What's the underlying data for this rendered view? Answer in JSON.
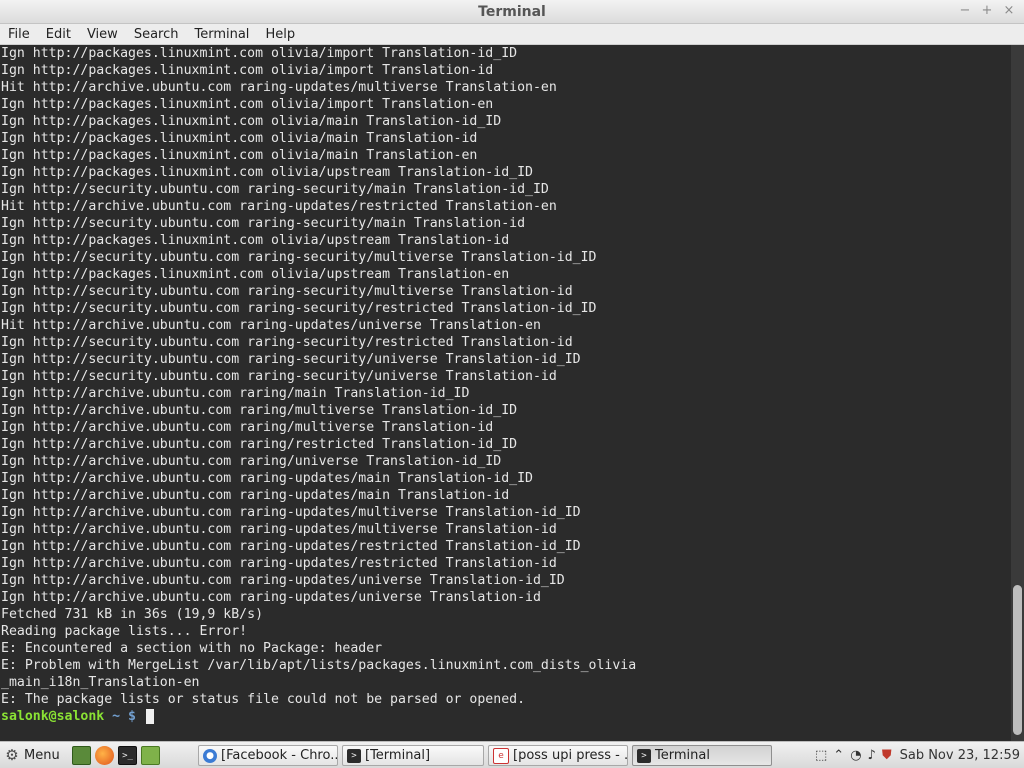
{
  "window": {
    "title": "Terminal"
  },
  "window_controls": {
    "minimize": "−",
    "maximize": "+",
    "close": "×"
  },
  "menubar": [
    "File",
    "Edit",
    "View",
    "Search",
    "Terminal",
    "Help"
  ],
  "terminal": {
    "lines": [
      "Ign http://packages.linuxmint.com olivia/import Translation-id_ID",
      "Ign http://packages.linuxmint.com olivia/import Translation-id",
      "Hit http://archive.ubuntu.com raring-updates/multiverse Translation-en",
      "Ign http://packages.linuxmint.com olivia/import Translation-en",
      "Ign http://packages.linuxmint.com olivia/main Translation-id_ID",
      "Ign http://packages.linuxmint.com olivia/main Translation-id",
      "Ign http://packages.linuxmint.com olivia/main Translation-en",
      "Ign http://packages.linuxmint.com olivia/upstream Translation-id_ID",
      "Ign http://security.ubuntu.com raring-security/main Translation-id_ID",
      "Hit http://archive.ubuntu.com raring-updates/restricted Translation-en",
      "Ign http://security.ubuntu.com raring-security/main Translation-id",
      "Ign http://packages.linuxmint.com olivia/upstream Translation-id",
      "Ign http://security.ubuntu.com raring-security/multiverse Translation-id_ID",
      "Ign http://packages.linuxmint.com olivia/upstream Translation-en",
      "Ign http://security.ubuntu.com raring-security/multiverse Translation-id",
      "Ign http://security.ubuntu.com raring-security/restricted Translation-id_ID",
      "Hit http://archive.ubuntu.com raring-updates/universe Translation-en",
      "Ign http://security.ubuntu.com raring-security/restricted Translation-id",
      "Ign http://security.ubuntu.com raring-security/universe Translation-id_ID",
      "Ign http://security.ubuntu.com raring-security/universe Translation-id",
      "Ign http://archive.ubuntu.com raring/main Translation-id_ID",
      "Ign http://archive.ubuntu.com raring/multiverse Translation-id_ID",
      "Ign http://archive.ubuntu.com raring/multiverse Translation-id",
      "Ign http://archive.ubuntu.com raring/restricted Translation-id_ID",
      "Ign http://archive.ubuntu.com raring/universe Translation-id_ID",
      "Ign http://archive.ubuntu.com raring-updates/main Translation-id_ID",
      "Ign http://archive.ubuntu.com raring-updates/main Translation-id",
      "Ign http://archive.ubuntu.com raring-updates/multiverse Translation-id_ID",
      "Ign http://archive.ubuntu.com raring-updates/multiverse Translation-id",
      "Ign http://archive.ubuntu.com raring-updates/restricted Translation-id_ID",
      "Ign http://archive.ubuntu.com raring-updates/restricted Translation-id",
      "Ign http://archive.ubuntu.com raring-updates/universe Translation-id_ID",
      "Ign http://archive.ubuntu.com raring-updates/universe Translation-id",
      "Fetched 731 kB in 36s (19,9 kB/s)",
      "Reading package lists... Error!",
      "E: Encountered a section with no Package: header",
      "E: Problem with MergeList /var/lib/apt/lists/packages.linuxmint.com_dists_olivia",
      "_main_i18n_Translation-en",
      "E: The package lists or status file could not be parsed or opened."
    ],
    "prompt": {
      "user_host": "salonk@salonk",
      "path": " ~ $ "
    }
  },
  "panel": {
    "menu_label": "Menu",
    "menu_icon": "gear-icon",
    "launchers": [
      "show-desktop-icon",
      "firefox-icon",
      "terminal-icon",
      "files-icon"
    ],
    "tasks": [
      {
        "label": "[Facebook - Chro...",
        "icon": "chrome-icon",
        "active": false
      },
      {
        "label": "[Terminal]",
        "icon": "terminal-icon",
        "active": false
      },
      {
        "label": "[poss upi press - ...",
        "icon": "document-icon",
        "active": false
      },
      {
        "label": "Terminal",
        "icon": "terminal-icon",
        "active": true
      }
    ],
    "tray_icons": [
      "network-icon",
      "chevron-up-icon",
      "wifi-icon",
      "volume-icon",
      "update-shield-icon"
    ],
    "clock": "Sab Nov 23, 12:59"
  },
  "colors": {
    "terminal_bg": "#2b2b2b",
    "terminal_fg": "#e6e6e6",
    "prompt_user": "#8ae234",
    "prompt_path": "#729fcf"
  }
}
